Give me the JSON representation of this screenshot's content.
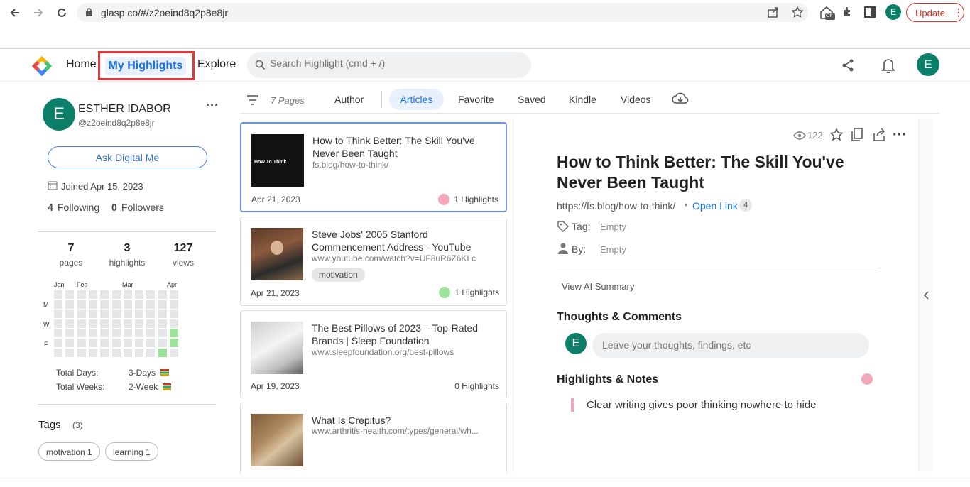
{
  "browser": {
    "url": "glasp.co/#/z2oeind8q2p8e8jr",
    "update_label": "Update",
    "profile_initial": "E",
    "ext_badge": "Off"
  },
  "header": {
    "home": "Home",
    "my_highlights": "My Highlights",
    "explore": "Explore",
    "search_placeholder": "Search Highlight (cmd + /)",
    "avatar_initial": "E"
  },
  "profile": {
    "initial": "E",
    "name": "ESTHER IDABOR",
    "handle": "@z2oeind8q2p8e8jr",
    "ask_label": "Ask Digital Me",
    "joined": "Joined Apr 15, 2023",
    "following_count": "4",
    "following_label": "Following",
    "followers_count": "0",
    "followers_label": "Followers",
    "stats": [
      {
        "value": "7",
        "label": "pages"
      },
      {
        "value": "3",
        "label": "highlights"
      },
      {
        "value": "127",
        "label": "views"
      }
    ],
    "months": [
      "Jan",
      "Feb",
      "Mar",
      "Apr"
    ],
    "weekdays": [
      "M",
      "W",
      "F"
    ],
    "total_days_label": "Total Days:",
    "total_days_value": "3-Days",
    "total_weeks_label": "Total Weeks:",
    "total_weeks_value": "2-Week",
    "tags_title": "Tags",
    "tags_count": "(3)",
    "tags": [
      "motivation 1",
      "learning 1"
    ],
    "activity_color": "#9be29b"
  },
  "tabs": {
    "pages_count": "7 Pages",
    "items": [
      "Author",
      "Articles",
      "Favorite",
      "Saved",
      "Kindle",
      "Videos"
    ],
    "active": "Articles"
  },
  "cards": [
    {
      "title": "How to Think Better: The Skill You've Never Been Taught",
      "url": "fs.blog/how-to-think/",
      "tag": "",
      "date": "Apr 21, 2023",
      "highlights": "1 Highlights",
      "dot": "#f4a7b9",
      "thumb_text": "How To Think"
    },
    {
      "title": "Steve Jobs' 2005 Stanford Commencement Address - YouTube",
      "url": "www.youtube.com/watch?v=UF8uR6Z6KLc",
      "tag": "motivation",
      "date": "Apr 21, 2023",
      "highlights": "1 Highlights",
      "dot": "#9be29b"
    },
    {
      "title": "The Best Pillows of 2023 – Top-Rated Brands | Sleep Foundation",
      "url": "www.sleepfoundation.org/best-pillows",
      "tag": "",
      "date": "Apr 19, 2023",
      "highlights": "0 Highlights",
      "dot": ""
    },
    {
      "title": "What Is Crepitus?",
      "url": "www.arthritis-health.com/types/general/wh...",
      "tag": "",
      "date": "",
      "highlights": "",
      "dot": ""
    }
  ],
  "detail": {
    "views": "122",
    "title": "How to Think Better: The Skill You've Never Been Taught",
    "url": "https://fs.blog/how-to-think/",
    "separator": "•",
    "open_link": "Open Link",
    "link_count": "4",
    "tag_label": "Tag:",
    "tag_value": "Empty",
    "by_label": "By:",
    "by_value": "Empty",
    "ai_summary": "View AI Summary",
    "thoughts_title": "Thoughts & Comments",
    "comment_initial": "E",
    "comment_placeholder": "Leave your thoughts, findings, etc",
    "highlights_title": "Highlights & Notes",
    "highlight_color": "#f4a7b9",
    "highlights": [
      "Clear writing gives poor thinking nowhere to hide"
    ]
  }
}
